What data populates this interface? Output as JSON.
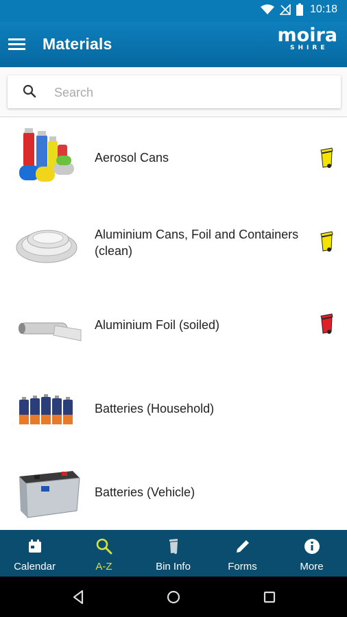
{
  "status": {
    "time": "10:18"
  },
  "header": {
    "title": "Materials",
    "brand_name": "moira",
    "brand_sub": "SHIRE"
  },
  "search": {
    "placeholder": "Search",
    "value": ""
  },
  "items": [
    {
      "label": "Aerosol Cans",
      "bin": "yellow"
    },
    {
      "label": "Aluminium Cans, Foil and Containers (clean)",
      "bin": "yellow"
    },
    {
      "label": "Aluminium Foil (soiled)",
      "bin": "red"
    },
    {
      "label": "Batteries (Household)",
      "bin": ""
    },
    {
      "label": "Batteries (Vehicle)",
      "bin": ""
    }
  ],
  "nav": [
    {
      "label": "Calendar",
      "icon": "calendar-icon",
      "active": false
    },
    {
      "label": "A-Z",
      "icon": "search-icon",
      "active": true
    },
    {
      "label": "Bin Info",
      "icon": "bin-icon",
      "active": false
    },
    {
      "label": "Forms",
      "icon": "pencil-icon",
      "active": false
    },
    {
      "label": "More",
      "icon": "info-icon",
      "active": false
    }
  ],
  "colors": {
    "accent": "#0b7bb8",
    "nav_bg": "#0a4d6e",
    "active": "#d7e23d",
    "bin_yellow": "#f2e300",
    "bin_red": "#e0202a"
  }
}
